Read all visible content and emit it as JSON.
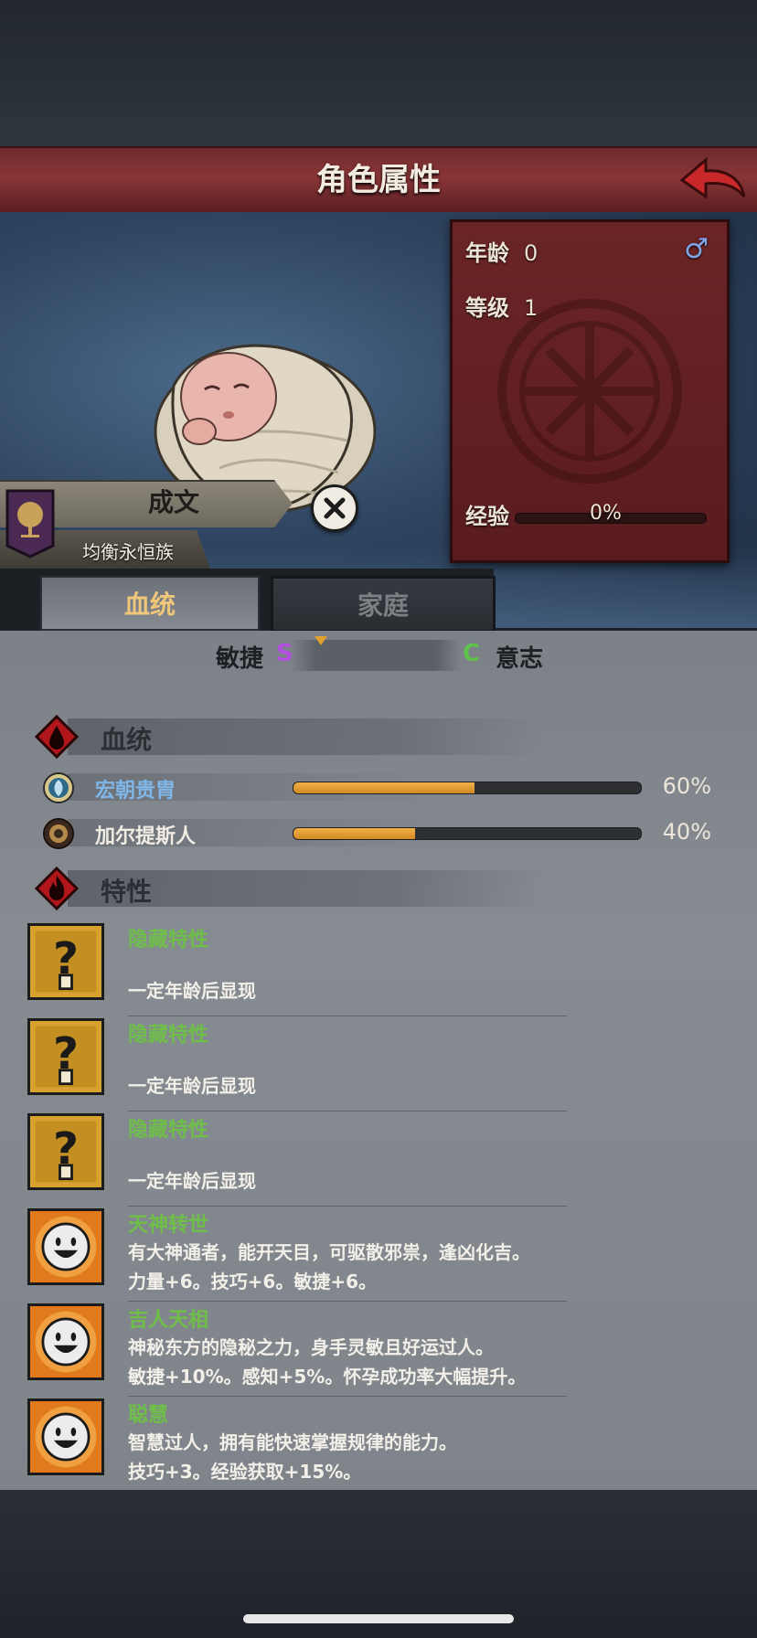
{
  "header": {
    "title": "角色属性",
    "back_icon": "red-back-arrow-icon"
  },
  "stats": {
    "age_label": "年龄",
    "age_value": "0",
    "level_label": "等级",
    "level_value": "1",
    "exp_label": "经验",
    "exp_value": "0%",
    "exp_fraction": 0,
    "gender_symbol": "♂"
  },
  "character": {
    "name": "成文",
    "clan": "均衡永恒族"
  },
  "tabs": [
    {
      "label": "血统",
      "active": true
    },
    {
      "label": "家庭",
      "active": false
    }
  ],
  "traits_scale": {
    "left_label": "敏捷",
    "left_grade": "S",
    "right_grade": "C",
    "right_label": "意志"
  },
  "lineage_section": {
    "title": "血统",
    "items": [
      {
        "name": "宏朝贵胄",
        "percent": "60%",
        "fraction": 0.6,
        "color": "#7fb6e8"
      },
      {
        "name": "加尔提斯人",
        "percent": "40%",
        "fraction": 0.4,
        "color": "#f0ece4"
      }
    ]
  },
  "traits_section": {
    "title": "特性",
    "items": [
      {
        "name": "隐藏特性",
        "line1": "",
        "line2": "一定年龄后显现",
        "icon": "question-mark-icon"
      },
      {
        "name": "隐藏特性",
        "line1": "",
        "line2": "一定年龄后显现",
        "icon": "question-mark-icon"
      },
      {
        "name": "隐藏特性",
        "line1": "",
        "line2": "一定年龄后显现",
        "icon": "question-mark-icon"
      },
      {
        "name": "天神转世",
        "line1": "有大神通者，能开天目，可驱散邪祟，逢凶化吉。",
        "line2": "力量+6。技巧+6。敏捷+6。",
        "icon": "smiley-face-icon"
      },
      {
        "name": "吉人天相",
        "line1": "神秘东方的隐秘之力，身手灵敏且好运过人。",
        "line2": "敏捷+10%。感知+5%。怀孕成功率大幅提升。",
        "icon": "smiley-face-icon"
      },
      {
        "name": "聪慧",
        "line1": "智慧过人，拥有能快速掌握规律的能力。",
        "line2": "技巧+3。经验获取+15%。",
        "icon": "smiley-face-icon"
      }
    ]
  },
  "colors": {
    "title_bar": "#8a3537",
    "panel": "#5a1c1f",
    "trait_name": "#6fbe4a",
    "bar_fill": "#e19a30",
    "active_tab_text": "#f0c778"
  }
}
